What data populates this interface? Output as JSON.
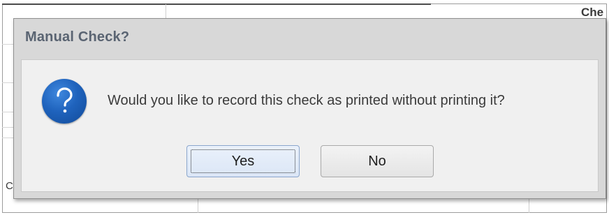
{
  "background": {
    "column_header": "Che",
    "left_glyph": "C"
  },
  "dialog": {
    "title": "Manual Check?",
    "icon": "question-icon",
    "message": "Would you like to record this check as printed without printing it?",
    "buttons": {
      "yes_label": "Yes",
      "no_label": "No"
    },
    "default_button": "Yes",
    "colors": {
      "icon_blue": "#1f63bd",
      "title_text": "#5a6472",
      "focused_button": "#dbe6f6"
    }
  }
}
